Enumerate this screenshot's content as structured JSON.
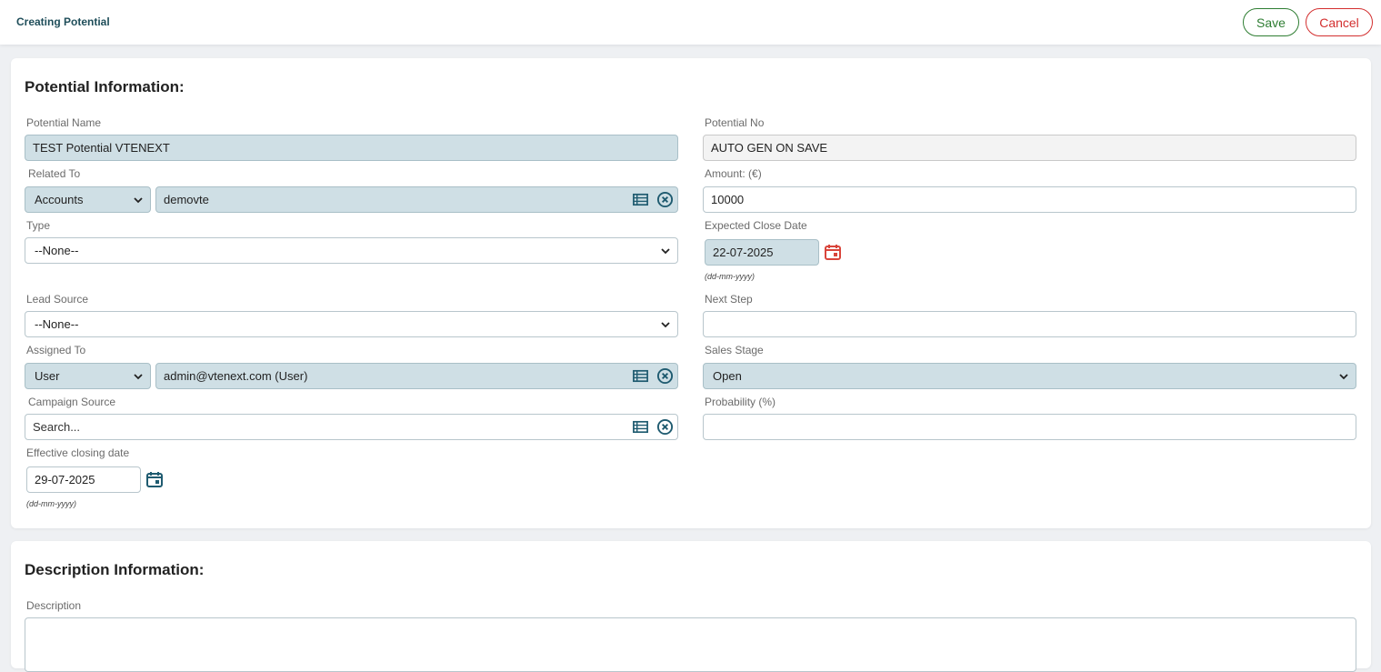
{
  "header": {
    "title": "Creating Potential",
    "save_label": "Save",
    "cancel_label": "Cancel"
  },
  "potential_info": {
    "title": "Potential Information:",
    "potential_name": {
      "label": "Potential Name",
      "value": "TEST Potential VTENEXT"
    },
    "potential_no": {
      "label": "Potential No",
      "value": "AUTO GEN ON SAVE"
    },
    "related_to": {
      "label": "Related To",
      "type_value": "Accounts",
      "value": "demovte"
    },
    "amount": {
      "label": "Amount: (€)",
      "value": "10000"
    },
    "type": {
      "label": "Type",
      "value": "--None--"
    },
    "expected_close_date": {
      "label": "Expected Close Date",
      "value": "22-07-2025",
      "hint": "(dd-mm-yyyy)"
    },
    "lead_source": {
      "label": "Lead Source",
      "value": "--None--"
    },
    "next_step": {
      "label": "Next Step",
      "value": ""
    },
    "assigned_to": {
      "label": "Assigned To",
      "type_value": "User",
      "value": "admin@vtenext.com (User)"
    },
    "sales_stage": {
      "label": "Sales Stage",
      "value": "Open"
    },
    "campaign_source": {
      "label": "Campaign Source",
      "placeholder": "Search..."
    },
    "probability": {
      "label": "Probability (%)",
      "value": ""
    },
    "effective_closing_date": {
      "label": "Effective closing date",
      "value": "29-07-2025",
      "hint": "(dd-mm-yyyy)"
    }
  },
  "description_info": {
    "title": "Description Information:",
    "description": {
      "label": "Description",
      "value": ""
    }
  },
  "icons": {
    "list": "list-icon",
    "clear": "clear-circle-icon",
    "calendar": "calendar-icon"
  },
  "colors": {
    "accent": "#1f5b70",
    "filled_bg": "#cfdfe5",
    "save": "#2e7d32",
    "cancel": "#d32f2f",
    "calendar_red": "#d9453b"
  }
}
